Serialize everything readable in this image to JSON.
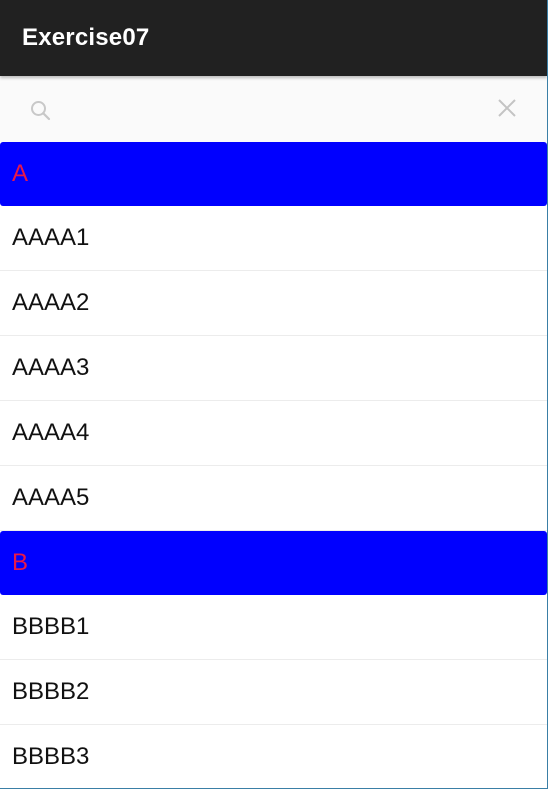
{
  "app_bar": {
    "title": "Exercise07",
    "background": "#212121"
  },
  "search": {
    "value": "",
    "placeholder": "",
    "search_icon": "search-icon",
    "clear_icon": "close-icon"
  },
  "sections": [
    {
      "header": "A",
      "items": [
        "AAAA1",
        "AAAA2",
        "AAAA3",
        "AAAA4",
        "AAAA5"
      ]
    },
    {
      "header": "B",
      "items": [
        "BBBB1",
        "BBBB2",
        "BBBB3"
      ]
    }
  ],
  "colors": {
    "section_header_bg": "#0000ff",
    "section_header_text": "#e8184a",
    "item_text": "#111111"
  }
}
